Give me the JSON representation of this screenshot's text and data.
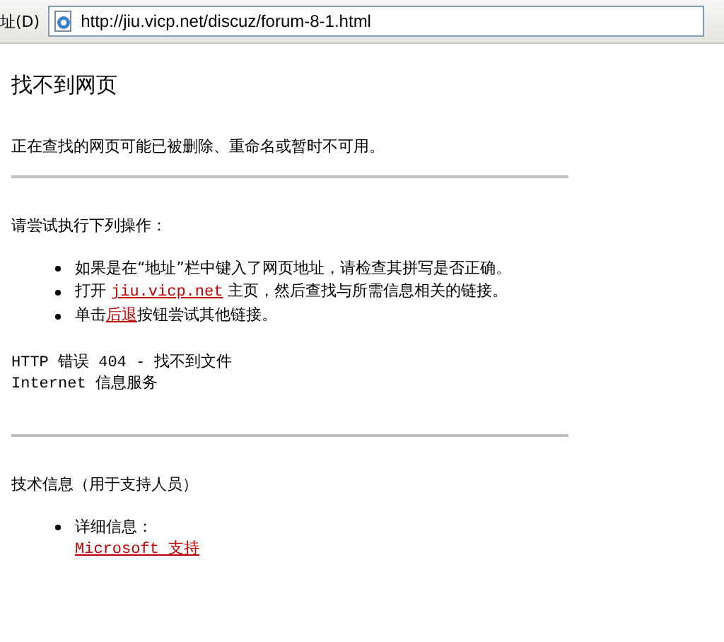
{
  "address_bar": {
    "label": "址(D)",
    "url": "http://jiu.vicp.net/discuz/forum-8-1.html"
  },
  "page": {
    "title": "找不到网页",
    "message": "正在查找的网页可能已被删除、重命名或暂时不可用。",
    "try_heading": "请尝试执行下列操作：",
    "suggestions": [
      [
        {
          "kind": "text",
          "text": "如果是在“地址”栏中键入了网页地址，请检查其拼写是否正确。"
        }
      ],
      [
        {
          "kind": "text",
          "text": "打开 "
        },
        {
          "kind": "link",
          "text": "jiu.vicp.net"
        },
        {
          "kind": "text",
          "text": " 主页，然后查找与所需信息相关的链接。"
        }
      ],
      [
        {
          "kind": "text",
          "text": "单击"
        },
        {
          "kind": "link",
          "text": "后退"
        },
        {
          "kind": "text",
          "text": "按钮尝试其他链接。"
        }
      ]
    ],
    "error_lines": [
      "HTTP 错误 404 - 找不到文件",
      "Internet 信息服务"
    ],
    "tech_heading": "技术信息（用于支持人员）",
    "details": {
      "label": "详细信息：",
      "link": "Microsoft 支持"
    }
  }
}
